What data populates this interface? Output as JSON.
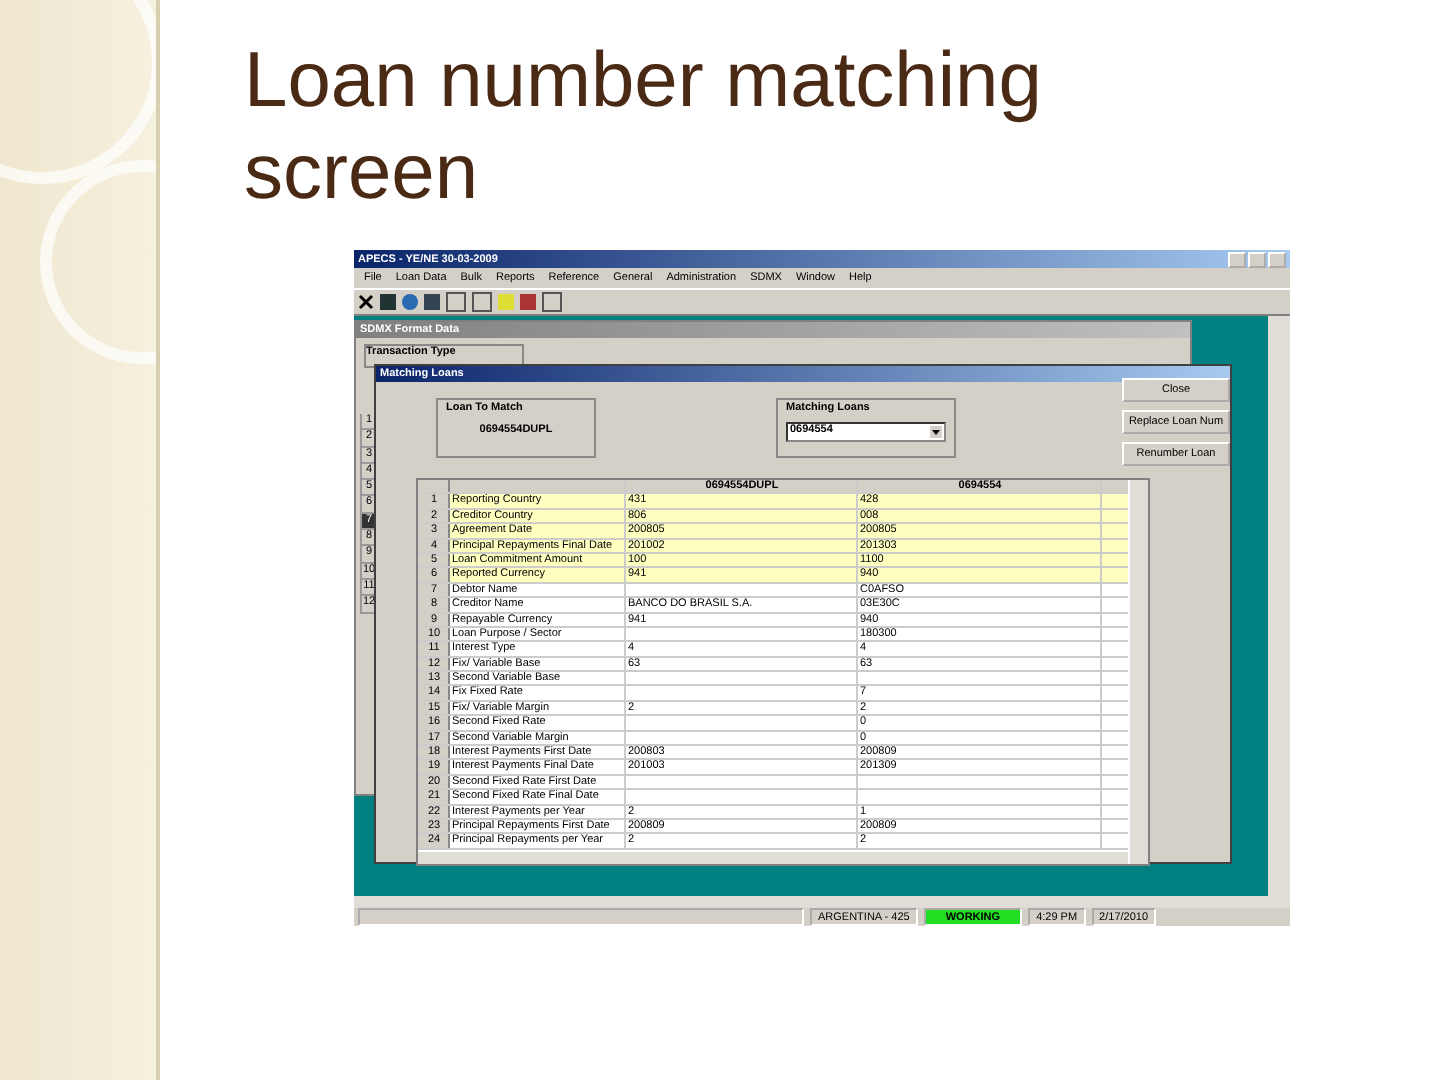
{
  "slide": {
    "title": "Loan number matching screen"
  },
  "window": {
    "title": "APECS - YE/NE 30-03-2009"
  },
  "menu": [
    "File",
    "Loan Data",
    "Bulk",
    "Reports",
    "Reference",
    "General",
    "Administration",
    "SDMX",
    "Window",
    "Help"
  ],
  "background_window": {
    "title": "SDMX Format Data",
    "group": "Transaction Type",
    "row_numbers": [
      {
        "label": "1",
        "selected": false
      },
      {
        "label": "2",
        "selected": false
      },
      {
        "label": "3",
        "selected": false
      },
      {
        "label": "4",
        "selected": false
      },
      {
        "label": "5",
        "selected": false
      },
      {
        "label": "6",
        "selected": false
      },
      {
        "label": "7",
        "selected": true
      },
      {
        "label": "8",
        "selected": false
      },
      {
        "label": "9",
        "selected": false
      },
      {
        "label": "10",
        "selected": false
      },
      {
        "label": "11",
        "selected": false
      },
      {
        "label": "12",
        "selected": false
      }
    ]
  },
  "dialog": {
    "title": "Matching Loans",
    "loan_to_match": {
      "label": "Loan To Match",
      "value": "0694554DUPL"
    },
    "matching_loans": {
      "label": "Matching Loans",
      "value": "0694554"
    },
    "buttons": [
      "Close",
      "Replace Loan Num",
      "Renumber Loan"
    ],
    "columns": [
      "0694554DUPL",
      "0694554"
    ],
    "rows": [
      {
        "num": "1",
        "label": "Reporting Country",
        "a": "431",
        "b": "428",
        "highlighted": true
      },
      {
        "num": "2",
        "label": "Creditor Country",
        "a": "806",
        "b": "008",
        "highlighted": true
      },
      {
        "num": "3",
        "label": "Agreement Date",
        "a": "200805",
        "b": "200805",
        "highlighted": true
      },
      {
        "num": "4",
        "label": "Principal Repayments Final Date",
        "a": "201002",
        "b": "201303",
        "highlighted": true
      },
      {
        "num": "5",
        "label": "Loan Commitment Amount",
        "a": "100",
        "b": "1100",
        "highlighted": true
      },
      {
        "num": "6",
        "label": "Reported Currency",
        "a": "941",
        "b": "940",
        "highlighted": true
      },
      {
        "num": "7",
        "label": "Debtor Name",
        "b": "C0AFSO",
        "highlighted": false
      },
      {
        "num": "8",
        "label": "Creditor Name",
        "a": "BANCO DO BRASIL S.A.",
        "b": "03E30C",
        "highlighted": false
      },
      {
        "num": "9",
        "label": "Repayable Currency",
        "a": "941",
        "b": "940",
        "highlighted": false
      },
      {
        "num": "10",
        "label": "Loan Purpose / Sector",
        "b": "180300",
        "highlighted": false
      },
      {
        "num": "11",
        "label": "Interest Type",
        "a": "4",
        "b": "4",
        "highlighted": false
      },
      {
        "num": "12",
        "label": "Fix/ Variable Base",
        "a": "63",
        "b": "63",
        "highlighted": false
      },
      {
        "num": "13",
        "label": "Second Variable Base",
        "highlighted": false
      },
      {
        "num": "14",
        "label": "Fix Fixed Rate",
        "b": "7",
        "highlighted": false
      },
      {
        "num": "15",
        "label": "Fix/ Variable Margin",
        "a": "2",
        "b": "2",
        "highlighted": false
      },
      {
        "num": "16",
        "label": "Second Fixed Rate",
        "b": "0",
        "highlighted": false
      },
      {
        "num": "17",
        "label": "Second Variable Margin",
        "b": "0",
        "highlighted": false
      },
      {
        "num": "18",
        "label": "Interest Payments First Date",
        "a": "200803",
        "b": "200809",
        "highlighted": false
      },
      {
        "num": "19",
        "label": "Interest Payments Final Date",
        "a": "201003",
        "b": "201309",
        "highlighted": false
      },
      {
        "num": "20",
        "label": "Second Fixed Rate First Date",
        "highlighted": false
      },
      {
        "num": "21",
        "label": "Second Fixed Rate Final Date",
        "highlighted": false
      },
      {
        "num": "22",
        "label": "Interest Payments per Year",
        "a": "2",
        "b": "1",
        "highlighted": false
      },
      {
        "num": "23",
        "label": "Principal Repayments First Date",
        "a": "200809",
        "b": "200809",
        "highlighted": false
      },
      {
        "num": "24",
        "label": "Principal Repayments per Year",
        "a": "2",
        "b": "2",
        "highlighted": false
      }
    ]
  },
  "status_bar": [
    {
      "text": "ARGENTINA - 425",
      "kind": "plain"
    },
    {
      "text": "WORKING",
      "kind": "busy"
    },
    {
      "text": "4:29 PM",
      "kind": "plain"
    },
    {
      "text": "2/17/2010",
      "kind": "plain"
    }
  ]
}
